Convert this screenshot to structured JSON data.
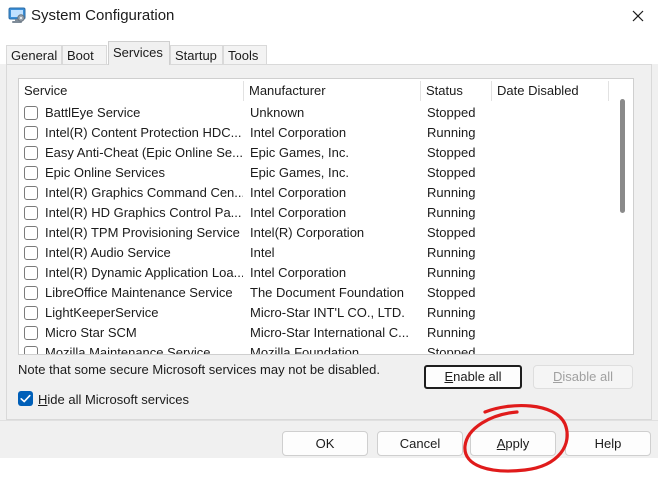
{
  "window": {
    "title": "System Configuration",
    "app_icon": "msconfig-icon",
    "close_icon": "close-icon"
  },
  "tabs": [
    {
      "label": "General",
      "active": false
    },
    {
      "label": "Boot",
      "active": false
    },
    {
      "label": "Services",
      "active": true
    },
    {
      "label": "Startup",
      "active": false
    },
    {
      "label": "Tools",
      "active": false
    }
  ],
  "services": {
    "columns": [
      "Service",
      "Manufacturer",
      "Status",
      "Date Disabled"
    ],
    "rows": [
      {
        "service": "BattlEye Service",
        "manufacturer": "Unknown",
        "status": "Stopped",
        "checked": false
      },
      {
        "service": "Intel(R) Content Protection HDC...",
        "manufacturer": "Intel Corporation",
        "status": "Running",
        "checked": false
      },
      {
        "service": "Easy Anti-Cheat (Epic Online Se...",
        "manufacturer": "Epic Games, Inc.",
        "status": "Stopped",
        "checked": false
      },
      {
        "service": "Epic Online Services",
        "manufacturer": "Epic Games, Inc.",
        "status": "Stopped",
        "checked": false
      },
      {
        "service": "Intel(R) Graphics Command Cen...",
        "manufacturer": "Intel Corporation",
        "status": "Running",
        "checked": false
      },
      {
        "service": "Intel(R) HD Graphics Control Pa...",
        "manufacturer": "Intel Corporation",
        "status": "Running",
        "checked": false
      },
      {
        "service": "Intel(R) TPM Provisioning Service",
        "manufacturer": "Intel(R) Corporation",
        "status": "Stopped",
        "checked": false
      },
      {
        "service": "Intel(R) Audio Service",
        "manufacturer": "Intel",
        "status": "Running",
        "checked": false
      },
      {
        "service": "Intel(R) Dynamic Application Loa...",
        "manufacturer": "Intel Corporation",
        "status": "Running",
        "checked": false
      },
      {
        "service": "LibreOffice Maintenance Service",
        "manufacturer": "The Document Foundation",
        "status": "Stopped",
        "checked": false
      },
      {
        "service": "LightKeeperService",
        "manufacturer": "Micro-Star INT'L CO., LTD.",
        "status": "Running",
        "checked": false
      },
      {
        "service": "Micro Star SCM",
        "manufacturer": "Micro-Star International C...",
        "status": "Running",
        "checked": false
      },
      {
        "service": "Mozilla Maintenance Service",
        "manufacturer": "Mozilla Foundation",
        "status": "Stopped",
        "checked": false
      }
    ]
  },
  "note": "Note that some secure Microsoft services may not be disabled.",
  "buttons": {
    "enable_all": {
      "pre": "",
      "key": "E",
      "post": "nable all"
    },
    "disable_all": {
      "pre": "",
      "key": "D",
      "post": "isable all"
    },
    "ok": "OK",
    "cancel": "Cancel",
    "apply": {
      "pre": "",
      "key": "A",
      "post": "pply"
    },
    "help": "Help"
  },
  "hide_ms": {
    "pre": "",
    "key": "H",
    "post": "ide all Microsoft services",
    "checked": true
  },
  "colors": {
    "accent": "#005fb8",
    "annotation": "#e01b1b"
  }
}
